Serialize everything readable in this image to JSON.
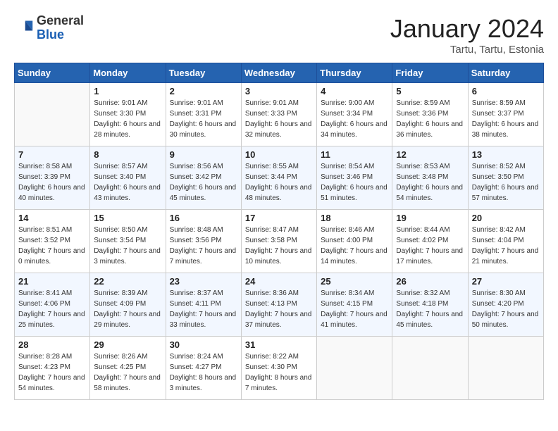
{
  "header": {
    "logo": {
      "general": "General",
      "blue": "Blue"
    },
    "title": "January 2024",
    "location": "Tartu, Tartu, Estonia"
  },
  "weekdays": [
    "Sunday",
    "Monday",
    "Tuesday",
    "Wednesday",
    "Thursday",
    "Friday",
    "Saturday"
  ],
  "weeks": [
    [
      {
        "day": null
      },
      {
        "day": 1,
        "sunrise": "9:01 AM",
        "sunset": "3:30 PM",
        "daylight": "6 hours and 28 minutes."
      },
      {
        "day": 2,
        "sunrise": "9:01 AM",
        "sunset": "3:31 PM",
        "daylight": "6 hours and 30 minutes."
      },
      {
        "day": 3,
        "sunrise": "9:01 AM",
        "sunset": "3:33 PM",
        "daylight": "6 hours and 32 minutes."
      },
      {
        "day": 4,
        "sunrise": "9:00 AM",
        "sunset": "3:34 PM",
        "daylight": "6 hours and 34 minutes."
      },
      {
        "day": 5,
        "sunrise": "8:59 AM",
        "sunset": "3:36 PM",
        "daylight": "6 hours and 36 minutes."
      },
      {
        "day": 6,
        "sunrise": "8:59 AM",
        "sunset": "3:37 PM",
        "daylight": "6 hours and 38 minutes."
      }
    ],
    [
      {
        "day": 7,
        "sunrise": "8:58 AM",
        "sunset": "3:39 PM",
        "daylight": "6 hours and 40 minutes."
      },
      {
        "day": 8,
        "sunrise": "8:57 AM",
        "sunset": "3:40 PM",
        "daylight": "6 hours and 43 minutes."
      },
      {
        "day": 9,
        "sunrise": "8:56 AM",
        "sunset": "3:42 PM",
        "daylight": "6 hours and 45 minutes."
      },
      {
        "day": 10,
        "sunrise": "8:55 AM",
        "sunset": "3:44 PM",
        "daylight": "6 hours and 48 minutes."
      },
      {
        "day": 11,
        "sunrise": "8:54 AM",
        "sunset": "3:46 PM",
        "daylight": "6 hours and 51 minutes."
      },
      {
        "day": 12,
        "sunrise": "8:53 AM",
        "sunset": "3:48 PM",
        "daylight": "6 hours and 54 minutes."
      },
      {
        "day": 13,
        "sunrise": "8:52 AM",
        "sunset": "3:50 PM",
        "daylight": "6 hours and 57 minutes."
      }
    ],
    [
      {
        "day": 14,
        "sunrise": "8:51 AM",
        "sunset": "3:52 PM",
        "daylight": "7 hours and 0 minutes."
      },
      {
        "day": 15,
        "sunrise": "8:50 AM",
        "sunset": "3:54 PM",
        "daylight": "7 hours and 3 minutes."
      },
      {
        "day": 16,
        "sunrise": "8:48 AM",
        "sunset": "3:56 PM",
        "daylight": "7 hours and 7 minutes."
      },
      {
        "day": 17,
        "sunrise": "8:47 AM",
        "sunset": "3:58 PM",
        "daylight": "7 hours and 10 minutes."
      },
      {
        "day": 18,
        "sunrise": "8:46 AM",
        "sunset": "4:00 PM",
        "daylight": "7 hours and 14 minutes."
      },
      {
        "day": 19,
        "sunrise": "8:44 AM",
        "sunset": "4:02 PM",
        "daylight": "7 hours and 17 minutes."
      },
      {
        "day": 20,
        "sunrise": "8:42 AM",
        "sunset": "4:04 PM",
        "daylight": "7 hours and 21 minutes."
      }
    ],
    [
      {
        "day": 21,
        "sunrise": "8:41 AM",
        "sunset": "4:06 PM",
        "daylight": "7 hours and 25 minutes."
      },
      {
        "day": 22,
        "sunrise": "8:39 AM",
        "sunset": "4:09 PM",
        "daylight": "7 hours and 29 minutes."
      },
      {
        "day": 23,
        "sunrise": "8:37 AM",
        "sunset": "4:11 PM",
        "daylight": "7 hours and 33 minutes."
      },
      {
        "day": 24,
        "sunrise": "8:36 AM",
        "sunset": "4:13 PM",
        "daylight": "7 hours and 37 minutes."
      },
      {
        "day": 25,
        "sunrise": "8:34 AM",
        "sunset": "4:15 PM",
        "daylight": "7 hours and 41 minutes."
      },
      {
        "day": 26,
        "sunrise": "8:32 AM",
        "sunset": "4:18 PM",
        "daylight": "7 hours and 45 minutes."
      },
      {
        "day": 27,
        "sunrise": "8:30 AM",
        "sunset": "4:20 PM",
        "daylight": "7 hours and 50 minutes."
      }
    ],
    [
      {
        "day": 28,
        "sunrise": "8:28 AM",
        "sunset": "4:23 PM",
        "daylight": "7 hours and 54 minutes."
      },
      {
        "day": 29,
        "sunrise": "8:26 AM",
        "sunset": "4:25 PM",
        "daylight": "7 hours and 58 minutes."
      },
      {
        "day": 30,
        "sunrise": "8:24 AM",
        "sunset": "4:27 PM",
        "daylight": "8 hours and 3 minutes."
      },
      {
        "day": 31,
        "sunrise": "8:22 AM",
        "sunset": "4:30 PM",
        "daylight": "8 hours and 7 minutes."
      },
      {
        "day": null
      },
      {
        "day": null
      },
      {
        "day": null
      }
    ]
  ]
}
